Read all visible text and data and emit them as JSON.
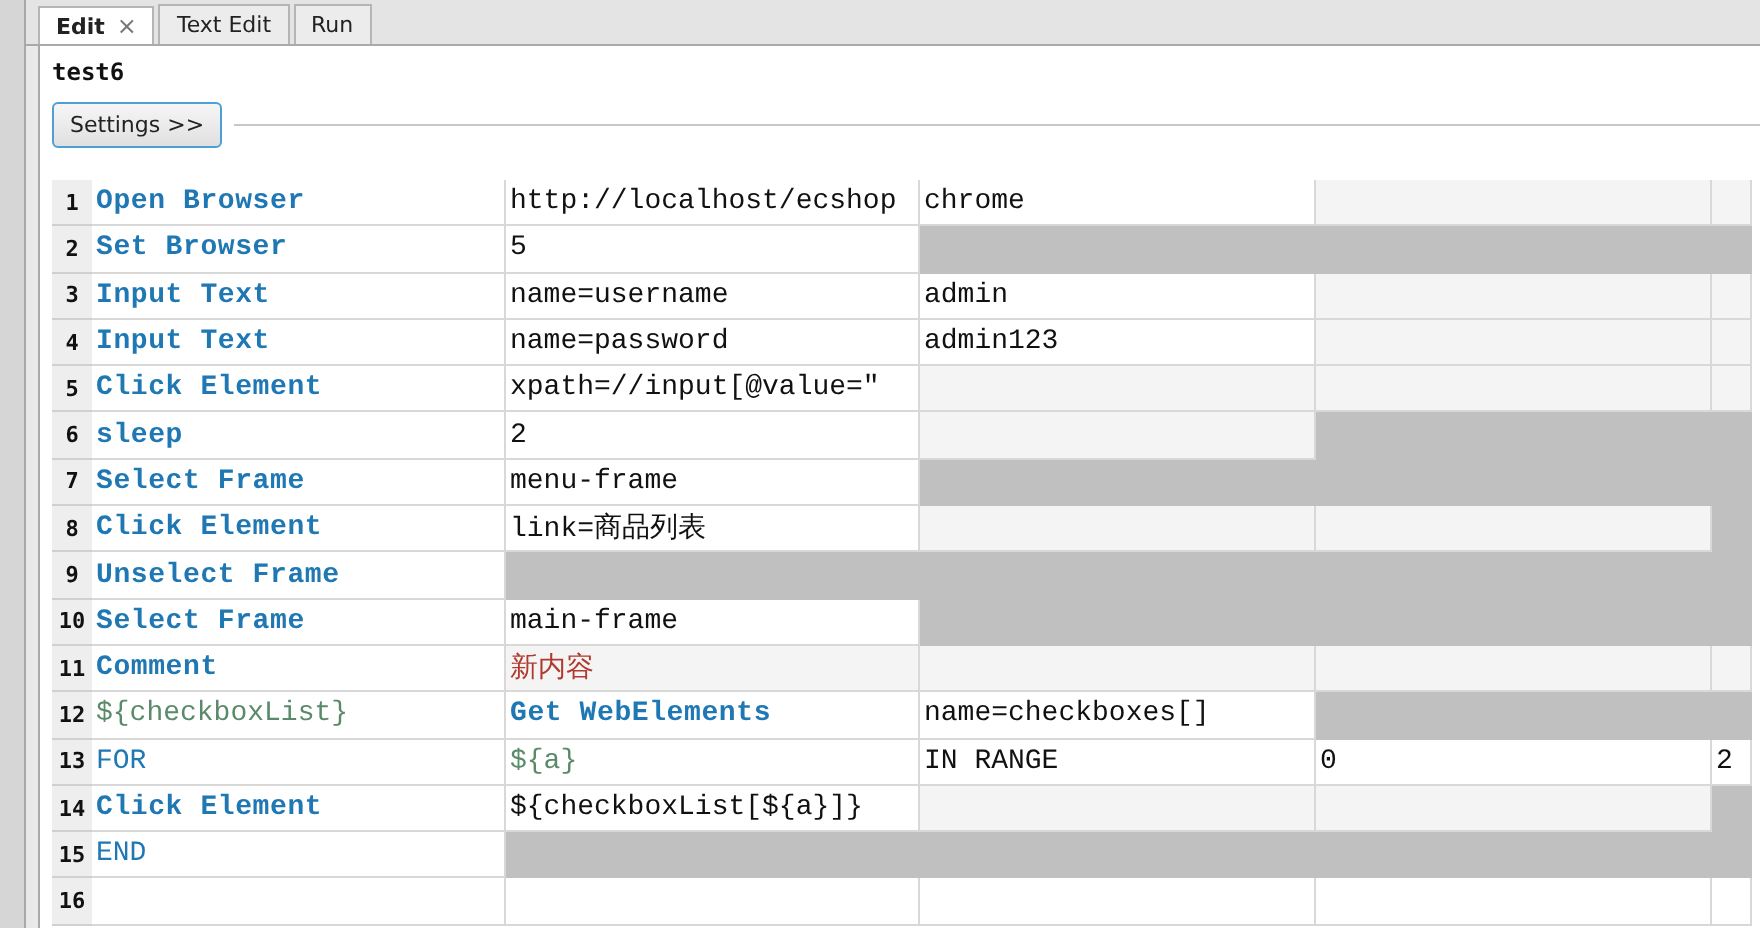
{
  "tabs": [
    {
      "label": "Edit",
      "selected": true,
      "close": "×"
    },
    {
      "label": "Text Edit",
      "selected": false
    },
    {
      "label": "Run",
      "selected": false
    }
  ],
  "test_name": "test6",
  "settings_button": "Settings >>",
  "rows": [
    {
      "number": "1",
      "cells": [
        {
          "text": "Open Browser",
          "kind": "keyword"
        },
        {
          "text": "http://localhost/ecshop",
          "kind": "argument"
        },
        {
          "text": "chrome",
          "kind": "argument"
        },
        {
          "kind": "empty"
        },
        {
          "kind": "empty"
        }
      ]
    },
    {
      "number": "2",
      "cells": [
        {
          "text": "Set Browser",
          "kind": "keyword"
        },
        {
          "text": "5",
          "kind": "argument"
        },
        {
          "kind": "disabled"
        },
        {
          "kind": "disabled"
        },
        {
          "kind": "disabled"
        }
      ]
    },
    {
      "number": "3",
      "cells": [
        {
          "text": "Input Text",
          "kind": "keyword"
        },
        {
          "text": "name=username",
          "kind": "argument"
        },
        {
          "text": "admin",
          "kind": "argument"
        },
        {
          "kind": "empty"
        },
        {
          "kind": "empty"
        }
      ]
    },
    {
      "number": "4",
      "cells": [
        {
          "text": "Input Text",
          "kind": "keyword"
        },
        {
          "text": "name=password",
          "kind": "argument"
        },
        {
          "text": "admin123",
          "kind": "argument"
        },
        {
          "kind": "empty"
        },
        {
          "kind": "empty"
        }
      ]
    },
    {
      "number": "5",
      "cells": [
        {
          "text": "Click Element",
          "kind": "keyword"
        },
        {
          "text": "xpath=//input[@value=\"",
          "kind": "argument"
        },
        {
          "kind": "empty"
        },
        {
          "kind": "empty"
        },
        {
          "kind": "empty"
        }
      ]
    },
    {
      "number": "6",
      "cells": [
        {
          "text": "sleep",
          "kind": "keyword"
        },
        {
          "text": "2",
          "kind": "argument"
        },
        {
          "kind": "empty"
        },
        {
          "kind": "disabled"
        },
        {
          "kind": "disabled"
        }
      ]
    },
    {
      "number": "7",
      "cells": [
        {
          "text": "Select Frame",
          "kind": "keyword"
        },
        {
          "text": "menu-frame",
          "kind": "argument"
        },
        {
          "kind": "disabled"
        },
        {
          "kind": "disabled"
        },
        {
          "kind": "disabled"
        }
      ]
    },
    {
      "number": "8",
      "cells": [
        {
          "text": "Click Element",
          "kind": "keyword"
        },
        {
          "text": "link=商品列表",
          "kind": "argument"
        },
        {
          "kind": "empty"
        },
        {
          "kind": "empty"
        },
        {
          "kind": "disabled"
        }
      ]
    },
    {
      "number": "9",
      "cells": [
        {
          "text": "Unselect Frame",
          "kind": "keyword"
        },
        {
          "kind": "disabled"
        },
        {
          "kind": "disabled"
        },
        {
          "kind": "disabled"
        },
        {
          "kind": "disabled"
        }
      ]
    },
    {
      "number": "10",
      "cells": [
        {
          "text": "Select Frame",
          "kind": "keyword"
        },
        {
          "text": "main-frame",
          "kind": "argument"
        },
        {
          "kind": "disabled"
        },
        {
          "kind": "disabled"
        },
        {
          "kind": "disabled"
        }
      ]
    },
    {
      "number": "11",
      "cells": [
        {
          "text": "Comment",
          "kind": "keyword"
        },
        {
          "text": "新内容",
          "kind": "comment"
        },
        {
          "kind": "empty"
        },
        {
          "kind": "empty"
        },
        {
          "kind": "empty"
        }
      ]
    },
    {
      "number": "12",
      "cells": [
        {
          "text": "${checkboxList}",
          "kind": "variable"
        },
        {
          "text": "Get WebElements",
          "kind": "keyword"
        },
        {
          "text": "name=checkboxes[]",
          "kind": "argument"
        },
        {
          "kind": "disabled"
        },
        {
          "kind": "disabled"
        }
      ]
    },
    {
      "number": "13",
      "cells": [
        {
          "text": "FOR",
          "kind": "control"
        },
        {
          "text": "${a}",
          "kind": "variable"
        },
        {
          "text": "IN RANGE",
          "kind": "argument"
        },
        {
          "text": "0",
          "kind": "argument"
        },
        {
          "text": "2",
          "kind": "argument"
        }
      ]
    },
    {
      "number": "14",
      "cells": [
        {
          "text": "Click Element",
          "kind": "keyword"
        },
        {
          "text": "${checkboxList[${a}]}",
          "kind": "argument"
        },
        {
          "kind": "empty"
        },
        {
          "kind": "empty"
        },
        {
          "kind": "disabled"
        }
      ]
    },
    {
      "number": "15",
      "cells": [
        {
          "text": "END",
          "kind": "control"
        },
        {
          "kind": "disabled"
        },
        {
          "kind": "disabled"
        },
        {
          "kind": "disabled"
        },
        {
          "kind": "disabled"
        }
      ]
    },
    {
      "number": "16",
      "cells": [
        {
          "kind": "blank"
        },
        {
          "kind": "blank"
        },
        {
          "kind": "blank"
        },
        {
          "kind": "blank"
        },
        {
          "kind": "blank"
        }
      ]
    }
  ]
}
